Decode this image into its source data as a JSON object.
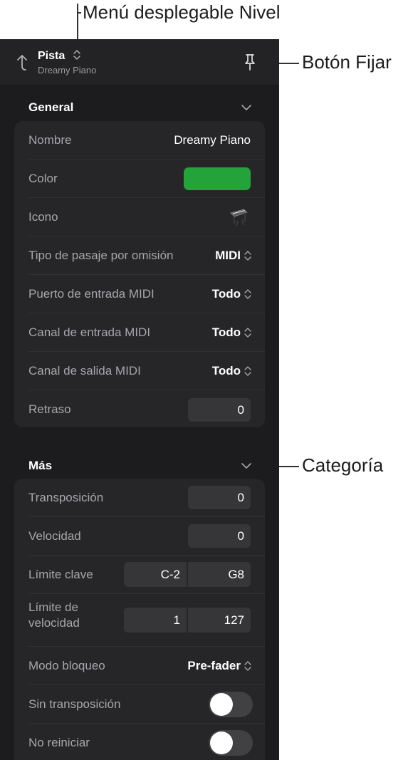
{
  "callouts": {
    "level_menu": "Menú desplegable Nivel",
    "pin_button": "Botón Fijar",
    "category": "Categoría"
  },
  "header": {
    "title": "Pista",
    "subtitle": "Dreamy Piano"
  },
  "sections": {
    "general": {
      "title": "General",
      "rows": {
        "nombre": {
          "label": "Nombre",
          "value": "Dreamy Piano"
        },
        "color": {
          "label": "Color",
          "color": "#23a33a"
        },
        "icono": {
          "label": "Icono",
          "icon": "piano-icon"
        },
        "tipo_pasaje": {
          "label": "Tipo de pasaje por omisión",
          "value": "MIDI"
        },
        "puerto_entrada": {
          "label": "Puerto de entrada MIDI",
          "value": "Todo"
        },
        "canal_entrada": {
          "label": "Canal de entrada MIDI",
          "value": "Todo"
        },
        "canal_salida": {
          "label": "Canal de salida MIDI",
          "value": "Todo"
        },
        "retraso": {
          "label": "Retraso",
          "value": "0"
        }
      }
    },
    "mas": {
      "title": "Más",
      "rows": {
        "transposicion": {
          "label": "Transposición",
          "value": "0"
        },
        "velocidad": {
          "label": "Velocidad",
          "value": "0"
        },
        "limite_clave": {
          "label": "Límite clave",
          "low": "C-2",
          "high": "G8"
        },
        "limite_velocidad": {
          "label_line1": "Límite de",
          "label_line2": "velocidad",
          "low": "1",
          "high": "127"
        },
        "modo_bloqueo": {
          "label": "Modo bloqueo",
          "value": "Pre-fader"
        },
        "sin_transposicion": {
          "label": "Sin transposición",
          "on": false
        },
        "no_reiniciar": {
          "label": "No reiniciar",
          "on": false
        }
      }
    }
  }
}
